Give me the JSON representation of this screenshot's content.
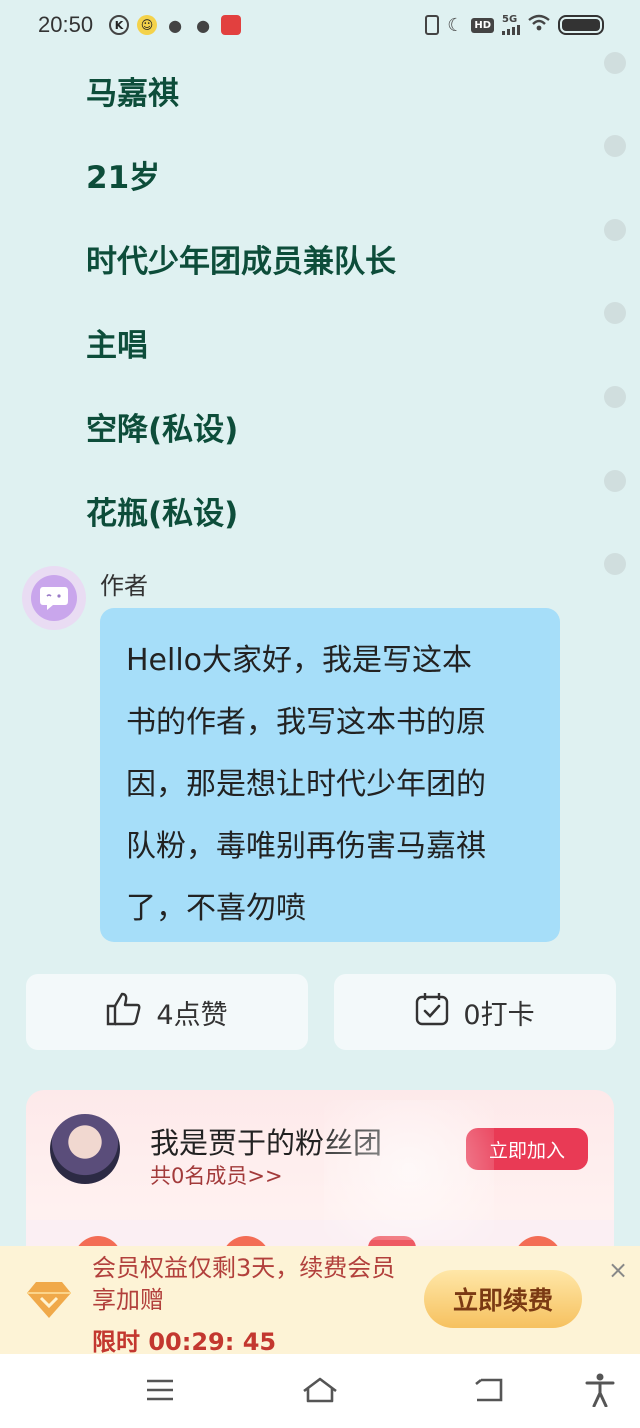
{
  "status": {
    "time": "20:50",
    "network": "5G",
    "hd": "HD"
  },
  "profile_lines": [
    "马嘉祺",
    "21岁",
    "时代少年团成员兼队长",
    "主唱",
    "空降(私设)",
    "花瓶(私设)"
  ],
  "author_message": {
    "name": "作者",
    "lines": [
      "Hello大家好，我是写这本",
      "书的作者，我写这本书的原",
      "因，那是想让时代少年团的",
      "队粉，毒唯别再伤害马嘉祺",
      "了，不喜勿喷"
    ]
  },
  "actions": {
    "like_label": "4点赞",
    "checkin_label": "0打卡"
  },
  "fan_club": {
    "title": "我是贾于的粉丝团",
    "members": "共0名成员>>",
    "join_label": "立即加入"
  },
  "membership": {
    "line1": "会员权益仅剩3天，续费会员",
    "line2": "享加赠",
    "timer": "限时 00:29: 45",
    "renew_label": "立即续费",
    "close": "×"
  },
  "icons": {
    "like": "thumbs-up-icon",
    "checkin": "calendar-check-icon",
    "menu": "menu-icon",
    "home": "home-icon",
    "back": "back-icon",
    "accessibility": "accessibility-icon"
  },
  "colors": {
    "background": "#dff1f1",
    "profile_text": "#0d4d3a",
    "bubble": "#a6def9",
    "join_button": "#e93a55",
    "banner": "#fdf3d6"
  }
}
